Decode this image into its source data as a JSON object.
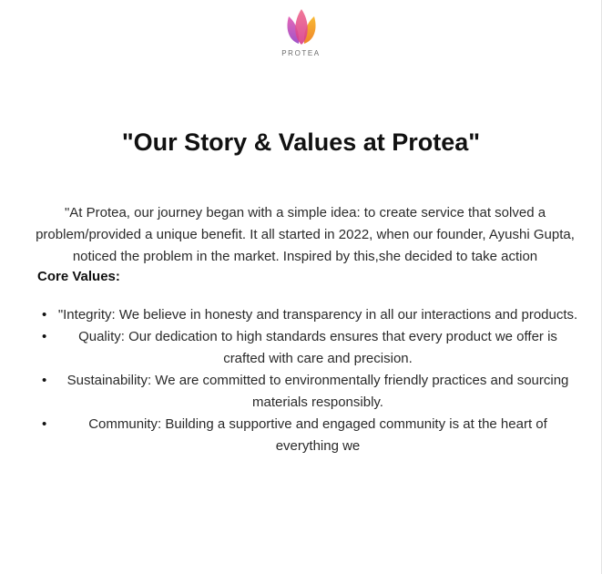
{
  "brand": {
    "name": "PROTEA",
    "colors": {
      "petal_left": "#c64fb8",
      "petal_center": "#e0448e",
      "petal_right": "#f4a11a"
    }
  },
  "page": {
    "title": "\"Our Story & Values at Protea\"",
    "intro": "\"At Protea, our journey began with a simple idea: to create service that solved a problem/provided a unique benefit. It all started in 2022, when our founder, Ayushi Gupta, noticed  the problem in the market. Inspired by this,she decided to take action",
    "core_values_heading": "Core Values:",
    "bullet_glyph": "•",
    "core_values": [
      "\"Integrity: We believe in honesty and transparency in all our interactions and products.",
      "Quality: Our dedication to high standards ensures that every product we offer is crafted with care and precision.",
      "Sustainability: We are committed to environmentally friendly practices and sourcing materials responsibly.",
      "Community: Building a supportive and engaged community is at the heart of everything we"
    ]
  }
}
